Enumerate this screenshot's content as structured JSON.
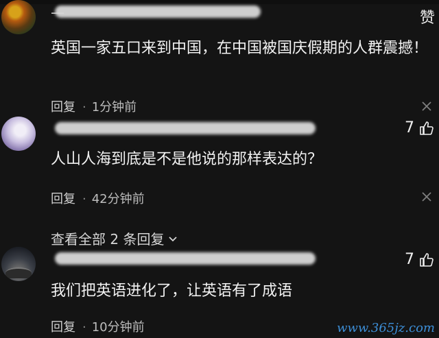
{
  "comments": [
    {
      "username": "—",
      "text": "英国一家五口来到中国，在中国被国庆假期的人群震撼！",
      "reply_label": "回复",
      "time": "1分钟前",
      "like": {
        "label": "赞",
        "count": ""
      }
    },
    {
      "username": "",
      "text": "人山人海到底是不是他说的那样表达的？",
      "reply_label": "回复",
      "time": "42分钟前",
      "like": {
        "label": "",
        "count": "7"
      },
      "view_more": "查看全部 2 条回复"
    },
    {
      "username": "",
      "text": "我们把英语进化了，让英语有了成语",
      "reply_label": "回复",
      "time": "10分钟前",
      "like": {
        "label": "",
        "count": "7"
      }
    }
  ],
  "watermark": "www.365jz.com",
  "icons": [
    "close-icon",
    "thumbs-up-icon",
    "chevron-down-icon"
  ],
  "colors": {
    "background": "#141414",
    "text": "#f2f2f2",
    "meta": "#bdbdbd",
    "watermark": "#3d8fd8"
  }
}
